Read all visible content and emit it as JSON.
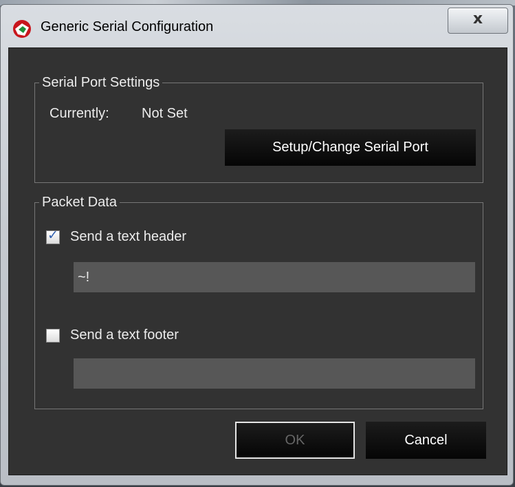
{
  "window": {
    "title": "Generic Serial Configuration",
    "close_label": "x"
  },
  "serial_port": {
    "legend": "Serial Port Settings",
    "current_label": "Currently:",
    "current_value": "Not Set",
    "setup_button": "Setup/Change Serial Port"
  },
  "packet_data": {
    "legend": "Packet Data",
    "header_checkbox": {
      "label": "Send a text header",
      "checked": true
    },
    "header_value": "~!",
    "footer_checkbox": {
      "label": "Send a text footer",
      "checked": false
    },
    "footer_value": ""
  },
  "buttons": {
    "ok": "OK",
    "cancel": "Cancel"
  },
  "icons": {
    "app": "app-icon",
    "close": "close-icon",
    "check": "checkmark-icon"
  },
  "colors": {
    "client_bg": "#323232",
    "checkmark": "#2f5fb0",
    "disabled_text": "#666666"
  }
}
